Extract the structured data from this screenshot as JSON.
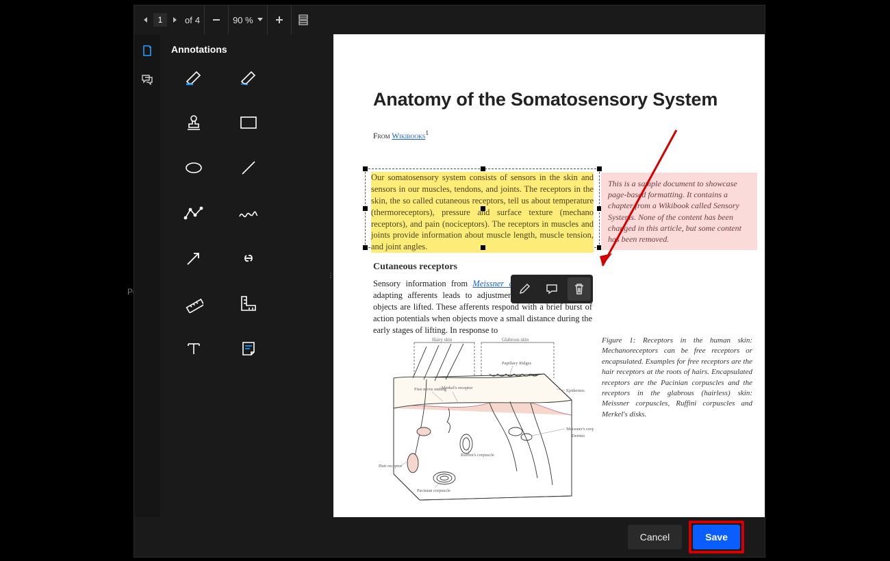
{
  "toolbar": {
    "page_current": "1",
    "page_sep": "of",
    "page_total": "4",
    "zoom": "90 %"
  },
  "sidebar": {
    "title": "Annotations"
  },
  "doc": {
    "title": "Anatomy of the Somatosensory System",
    "from_label": "From ",
    "from_link": "Wikibooks",
    "from_sup": "1",
    "highlight": "Our somatosensory system consists of sensors in the skin and sensors in our muscles, tendons, and joints. The receptors in the skin, the so called cutaneous receptors, tell us about temperature (thermoreceptors), pressure and surface texture (mechano receptors), and pain (nociceptors). The receptors in muscles and joints provide information about muscle length, muscle tension, and joint angles.",
    "pinkbox": "This is a sample document to showcase page-based formatting. It contains a chapter from a Wikibook called Sensory Systems. None of the content has been changed in this article, but some content has been removed.",
    "subhead": "Cutaneous receptors",
    "body_pre": "Sensory information from ",
    "body_link": "Meissner corpuscles",
    "body_post": " and rapidly adapting afferents leads to adjustment of grip force when objects are lifted. These afferents respond with a brief burst of action potentials when objects move a small distance during the early stages of lifting. In response to",
    "fig_caption": "Figure 1: Receptors in the human skin: Mechanoreceptors can be free receptors or encapsulated. Examples for free receptors are the hair receptors at the roots of hairs. Encapsulated receptors are the Pacinian corpuscles and the receptors in the glabrous (hairless) skin: Meissner corpuscles, Ruffini corpuscles and Merkel's disks.",
    "skin_labels": {
      "hairy": "Hairy skin",
      "glabrous": "Glabrous skin",
      "papillary": "Papillary Ridges",
      "nerve": "Free nerve ending",
      "merkel": "Merkel's receptor",
      "epidermis": "Epidermis",
      "meissner": "Meissner's corpuscle",
      "dermis": "Dermis",
      "hair": "Hair receptor",
      "ruffini": "Ruffini's corpuscle",
      "pacinian": "Pacinian corpuscle"
    }
  },
  "footer": {
    "cancel": "Cancel",
    "save": "Save"
  },
  "bg_peek": "Po"
}
